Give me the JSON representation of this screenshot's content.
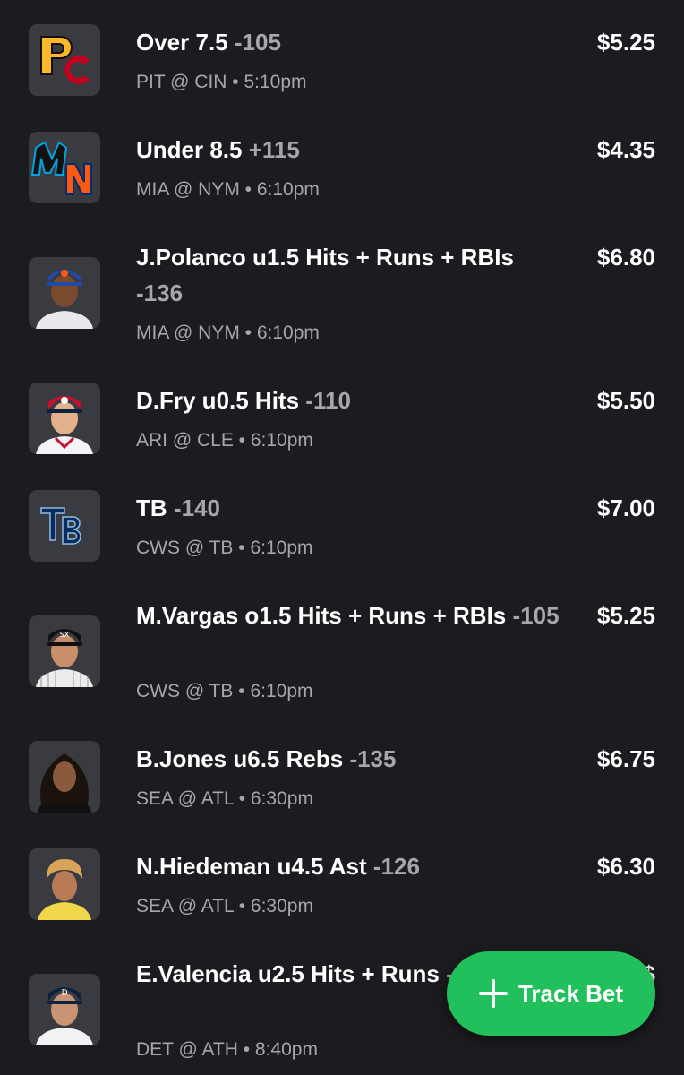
{
  "bets": [
    {
      "title": "Over 7.5",
      "odds": "-105",
      "matchup": "PIT @ CIN • 5:10pm",
      "amount": "$5.25",
      "icon": "pirates-reds-logo-icon"
    },
    {
      "title": "Under 8.5",
      "odds": "+115",
      "matchup": "MIA @ NYM • 6:10pm",
      "amount": "$4.35",
      "icon": "marlins-mets-logo-icon"
    },
    {
      "title": "J.Polanco u1.5 Hits + Runs + RBIs",
      "odds": "-136",
      "matchup": "MIA @ NYM • 6:10pm",
      "amount": "$6.80",
      "icon": "player-headshot-icon"
    },
    {
      "title": "D.Fry u0.5 Hits",
      "odds": "-110",
      "matchup": "ARI @ CLE • 6:10pm",
      "amount": "$5.50",
      "icon": "player-headshot-icon"
    },
    {
      "title": "TB",
      "odds": "-140",
      "matchup": "CWS @ TB • 6:10pm",
      "amount": "$7.00",
      "icon": "rays-logo-icon"
    },
    {
      "title": "M.Vargas o1.5 Hits + Runs + RBIs",
      "odds": "-105",
      "matchup": "CWS @ TB • 6:10pm",
      "amount": "$5.25",
      "icon": "player-headshot-icon"
    },
    {
      "title": "B.Jones u6.5 Rebs",
      "odds": "-135",
      "matchup": "SEA @ ATL • 6:30pm",
      "amount": "$6.75",
      "icon": "player-headshot-icon"
    },
    {
      "title": "N.Hiedeman u4.5 Ast",
      "odds": "-126",
      "matchup": "SEA @ ATL • 6:30pm",
      "amount": "$6.30",
      "icon": "player-headshot-icon"
    },
    {
      "title": "E.Valencia u2.5 Hits + Runs",
      "odds": "-130",
      "matchup": "DET @ ATH • 8:40pm",
      "amount": "$",
      "icon": "player-headshot-icon"
    }
  ],
  "fab": {
    "label": "Track Bet",
    "icon": "plus-icon"
  },
  "colors": {
    "background": "#1c1c20",
    "tile": "#3a3b41",
    "muted": "#a6a7ad",
    "accent": "#22c05c"
  }
}
